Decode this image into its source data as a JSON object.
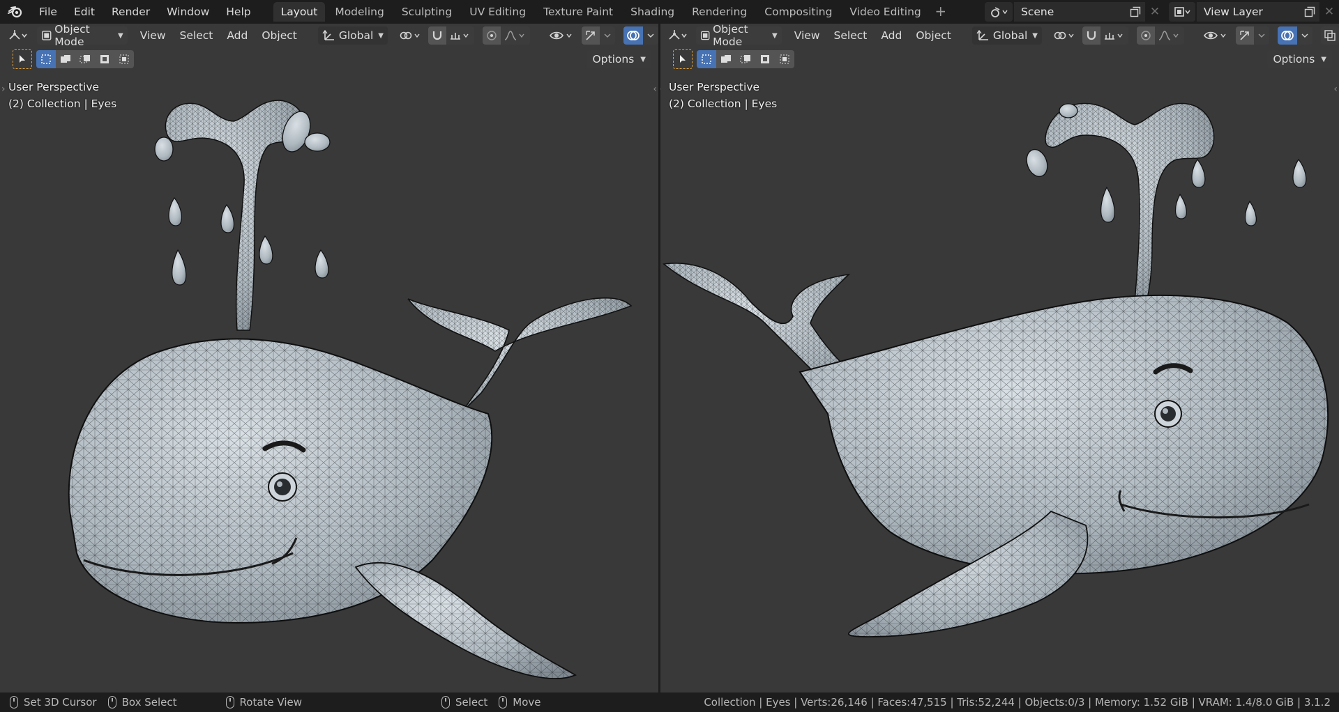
{
  "topbar": {
    "menu": [
      "File",
      "Edit",
      "Render",
      "Window",
      "Help"
    ],
    "tabs": [
      "Layout",
      "Modeling",
      "Sculpting",
      "UV Editing",
      "Texture Paint",
      "Shading",
      "Rendering",
      "Compositing",
      "Video Editing"
    ],
    "active_tab": "Layout",
    "add_tab": "+",
    "scene_name": "Scene",
    "view_layer_name": "View Layer"
  },
  "viewport": {
    "mode": "Object Mode",
    "menus": [
      "View",
      "Select",
      "Add",
      "Object"
    ],
    "transform_orientation": "Global",
    "options_label": "Options",
    "perspective_label": "User Perspective",
    "collection_label": "(2) Collection | Eyes"
  },
  "statusbar": {
    "hints": [
      "Set 3D Cursor",
      "Box Select",
      "Rotate View",
      "Select",
      "Move"
    ],
    "stats": "Collection | Eyes | Verts:26,146 | Faces:47,515 | Tris:52,244 | Objects:0/3 | Memory: 1.52 GiB | VRAM: 1.4/8.0 GiB | 3.1.2"
  },
  "colors": {
    "accent": "#4772b3",
    "viewport_bg": "#393939",
    "header_bg": "#1d1d1d",
    "select_tool": "#e3a13a",
    "mesh": "#aeb7be"
  }
}
